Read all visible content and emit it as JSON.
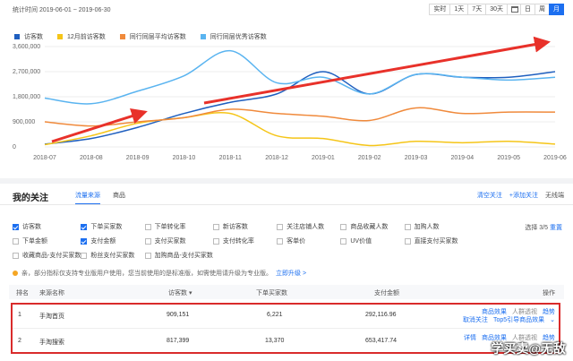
{
  "header": {
    "range_label": "统计时间 2019-06-01 ~ 2019-06-30",
    "periods": [
      "实时",
      "1天",
      "7天",
      "30天",
      "日",
      "周",
      "月"
    ],
    "active_period": "月",
    "calendar_icon": "calendar-icon"
  },
  "chart_data": {
    "type": "line",
    "x": [
      "2018-07",
      "2018-08",
      "2018-09",
      "2018-10",
      "2018-11",
      "2018-12",
      "2019-01",
      "2019-02",
      "2019-03",
      "2019-04",
      "2019-05",
      "2019-06"
    ],
    "yticks": [
      "3,600,000",
      "2,700,000",
      "1,800,000",
      "900,000",
      "0"
    ],
    "ylim": [
      0,
      3600000
    ],
    "grid": true,
    "legend_position": "top-left",
    "series": [
      {
        "name": "访客数",
        "color": "#1f5fbf",
        "values": [
          100000,
          300000,
          700000,
          1200000,
          1600000,
          1900000,
          2700000,
          1900000,
          2600000,
          2500000,
          2500000,
          2700000
        ]
      },
      {
        "name": "12月前访客数",
        "color": "#f5c518",
        "values": [
          80000,
          400000,
          850000,
          1050000,
          1200000,
          400000,
          300000,
          50000,
          200000,
          150000,
          200000,
          100000
        ]
      },
      {
        "name": "同行同层平均访客数",
        "color": "#f08a3c",
        "values": [
          900000,
          750000,
          900000,
          1050000,
          1350000,
          1200000,
          1100000,
          950000,
          1400000,
          1200000,
          1250000,
          1250000
        ]
      },
      {
        "name": "同行同层优秀访客数",
        "color": "#5ab4f0",
        "values": [
          1750000,
          1550000,
          2000000,
          2550000,
          3450000,
          2300000,
          2500000,
          1900000,
          2600000,
          2500000,
          2400000,
          2500000
        ]
      }
    ]
  },
  "follow": {
    "title": "我的关注",
    "tabs": [
      "流量来源",
      "商品"
    ],
    "active_tab": "流量来源",
    "tools": {
      "clear": "清空关注",
      "add": "+添加关注",
      "mode": "无线端"
    },
    "metrics": [
      {
        "label": "访客数",
        "checked": true
      },
      {
        "label": "下单买家数",
        "checked": true
      },
      {
        "label": "下单转化率",
        "checked": false
      },
      {
        "label": "新访客数",
        "checked": false
      },
      {
        "label": "关注店铺人数",
        "checked": false
      },
      {
        "label": "商品收藏人数",
        "checked": false
      },
      {
        "label": "加购人数",
        "checked": false
      },
      {
        "label": "",
        "checked": false
      },
      {
        "label": "下单金额",
        "checked": false
      },
      {
        "label": "支付金额",
        "checked": true
      },
      {
        "label": "支付买家数",
        "checked": false
      },
      {
        "label": "支付转化率",
        "checked": false
      },
      {
        "label": "客单价",
        "checked": false
      },
      {
        "label": "UV价值",
        "checked": false
      },
      {
        "label": "直接支付买家数",
        "checked": false
      },
      {
        "label": "",
        "checked": false
      },
      {
        "label": "收藏商品-支付买家数",
        "checked": false
      },
      {
        "label": "粉丝支付买家数",
        "checked": false
      },
      {
        "label": "加购商品-支付买家数",
        "checked": false
      }
    ],
    "selected_count": "选择 3/5",
    "reset": "重置",
    "notice": "亲，部分指标仅支持专业版用户使用，您当前使用的是标准版，如需使用请升级为专业版。",
    "upgrade": "立即升级 >"
  },
  "table": {
    "headers": {
      "rank": "排名",
      "source": "来源名称",
      "visitors": "访客数",
      "buyers": "下单买家数",
      "amount": "支付金额",
      "ops": "操作"
    },
    "rows": [
      {
        "rank": "1",
        "source": "手淘首页",
        "visitors": "909,151",
        "buyers": "6,221",
        "amount": "292,116.96",
        "ops1": [
          "商品效果",
          "人群透视",
          "趋势"
        ],
        "ops2": [
          "取消关注",
          "Top5引导商品效果"
        ]
      },
      {
        "rank": "2",
        "source": "手淘搜索",
        "visitors": "817,399",
        "buyers": "13,370",
        "amount": "653,417.74",
        "ops1": [
          "详情",
          "商品效果",
          "人群透视",
          "趋势"
        ]
      }
    ]
  },
  "watermark": "学买卖@无敌",
  "annotation_color": "#e8312a"
}
